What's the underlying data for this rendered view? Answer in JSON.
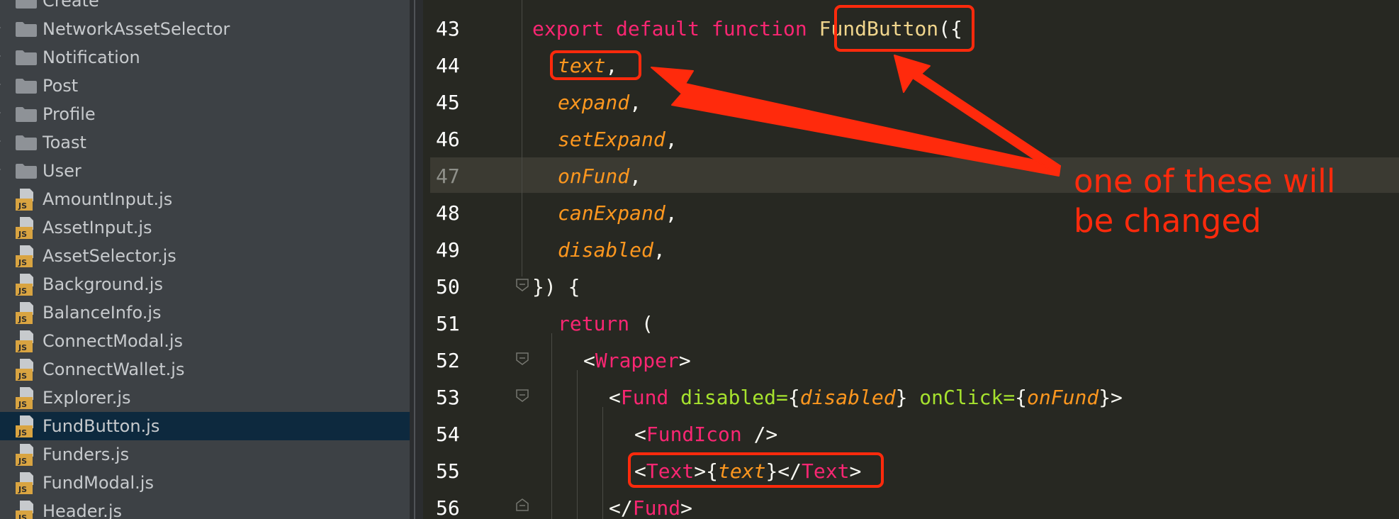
{
  "colors": {
    "sidebar_bg": "#3d4145",
    "editor_bg": "#272822",
    "selected_row": "#0d293e",
    "annotation": "#ff2a0c",
    "keyword": "#f92672",
    "param": "#fd971f",
    "attribute": "#a6e22e"
  },
  "sidebar": {
    "items": [
      {
        "label": "Create",
        "icon": "folder-icon"
      },
      {
        "label": "NetworkAssetSelector",
        "icon": "folder-icon"
      },
      {
        "label": "Notification",
        "icon": "folder-icon"
      },
      {
        "label": "Post",
        "icon": "folder-icon"
      },
      {
        "label": "Profile",
        "icon": "folder-icon"
      },
      {
        "label": "Toast",
        "icon": "folder-icon"
      },
      {
        "label": "User",
        "icon": "folder-icon"
      },
      {
        "label": "AmountInput.js",
        "icon": "js-file-icon"
      },
      {
        "label": "AssetInput.js",
        "icon": "js-file-icon"
      },
      {
        "label": "AssetSelector.js",
        "icon": "js-file-icon"
      },
      {
        "label": "Background.js",
        "icon": "js-file-icon"
      },
      {
        "label": "BalanceInfo.js",
        "icon": "js-file-icon"
      },
      {
        "label": "ConnectModal.js",
        "icon": "js-file-icon"
      },
      {
        "label": "ConnectWallet.js",
        "icon": "js-file-icon"
      },
      {
        "label": "Explorer.js",
        "icon": "js-file-icon"
      },
      {
        "label": "FundButton.js",
        "icon": "js-file-icon",
        "selected": true
      },
      {
        "label": "Funders.js",
        "icon": "js-file-icon"
      },
      {
        "label": "FundModal.js",
        "icon": "js-file-icon"
      },
      {
        "label": "Header.js",
        "icon": "js-file-icon"
      }
    ]
  },
  "editor": {
    "current_line": "47",
    "lines": [
      {
        "number": "43",
        "t1": "export",
        "t2": " default function ",
        "t3": "FundButton",
        "t4": "({"
      },
      {
        "number": "44",
        "param": "text",
        "punc": ","
      },
      {
        "number": "45",
        "param": "expand",
        "punc": ","
      },
      {
        "number": "46",
        "param": "setExpand",
        "punc": ","
      },
      {
        "number": "47",
        "param": "onFund",
        "punc": ","
      },
      {
        "number": "48",
        "param": "canExpand",
        "punc": ","
      },
      {
        "number": "49",
        "param": "disabled",
        "punc": ","
      },
      {
        "number": "50",
        "text": "}) {"
      },
      {
        "number": "51",
        "kw": "return",
        "rest": " ("
      },
      {
        "number": "52",
        "open": "<",
        "tag": "Wrapper",
        "close": ">"
      },
      {
        "number": "53",
        "open": "<",
        "tag": "Fund",
        "attr1": " disabled=",
        "b1": "{",
        "v1": "disabled",
        "b2": "}",
        "attr2": " onClick=",
        "b3": "{",
        "v2": "onFund",
        "b4": "}>"
      },
      {
        "number": "54",
        "open": "<",
        "tag": "FundIcon",
        "close": " />"
      },
      {
        "number": "55",
        "open": "<",
        "tag": "Text",
        "mid1": ">{",
        "param": "text",
        "mid2": "}</",
        "tag2": "Text",
        "close": ">"
      },
      {
        "number": "56",
        "open": "</",
        "tag": "Fund",
        "close": ">"
      }
    ]
  },
  "annotation": {
    "note_text": "one of these will\nbe changed"
  }
}
